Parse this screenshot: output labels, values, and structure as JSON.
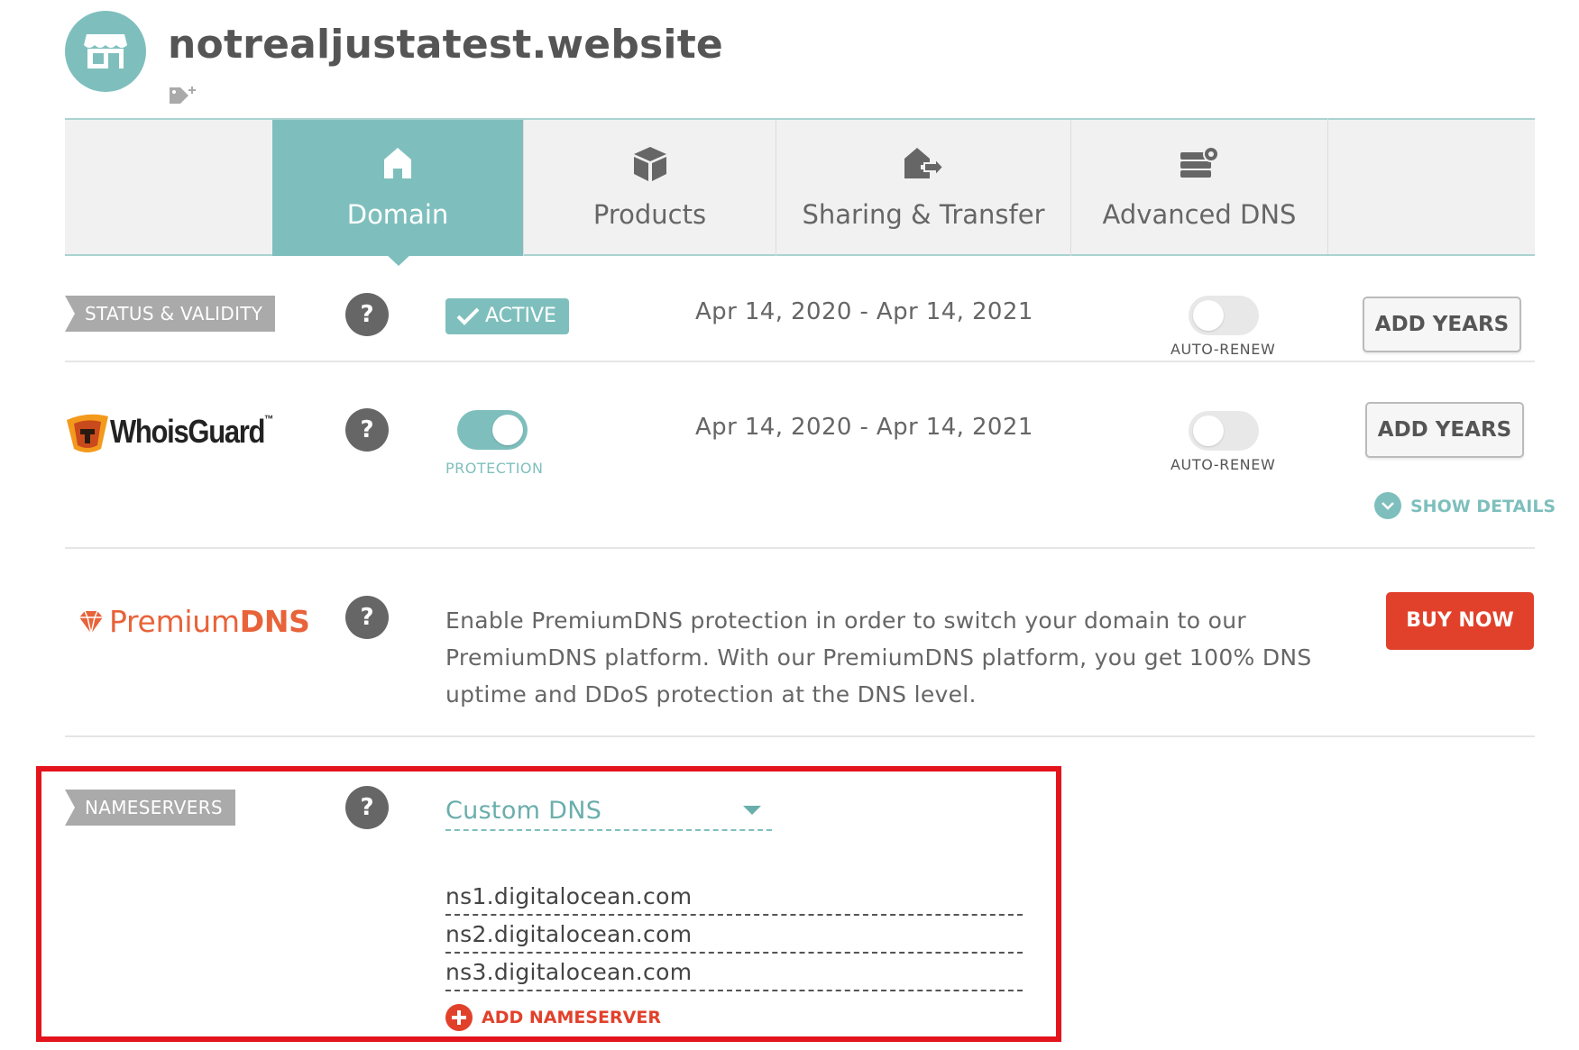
{
  "header": {
    "domain_name": "notrealjustatest.website",
    "avatar_icon": "storefront-icon",
    "tag_icon": "add-tag-icon"
  },
  "tabs": [
    {
      "label": "Domain",
      "icon": "home-icon",
      "active": true
    },
    {
      "label": "Products",
      "icon": "box-icon",
      "active": false
    },
    {
      "label": "Sharing & Transfer",
      "icon": "house-transfer-icon",
      "active": false
    },
    {
      "label": "Advanced DNS",
      "icon": "server-gear-icon",
      "active": false
    }
  ],
  "status": {
    "section_label": "STATUS & VALIDITY",
    "help": "?",
    "badge": "ACTIVE",
    "dates": "Apr 14, 2020 - Apr 14, 2021",
    "auto_renew_label": "AUTO-RENEW",
    "auto_renew_on": false,
    "add_years": "ADD YEARS"
  },
  "whoisguard": {
    "brand": "WhoisGuard",
    "trademark": "™",
    "help": "?",
    "protection_label": "PROTECTION",
    "protection_on": true,
    "dates": "Apr 14, 2020 - Apr 14, 2021",
    "auto_renew_label": "AUTO-RENEW",
    "auto_renew_on": false,
    "add_years": "ADD YEARS",
    "show_details": "SHOW DETAILS"
  },
  "premium_dns": {
    "brand_light": "Premium",
    "brand_bold": "DNS",
    "help": "?",
    "description": "Enable PremiumDNS protection in order to switch your domain to our PremiumDNS platform. With our PremiumDNS platform, you get 100% DNS uptime and DDoS protection at the DNS level.",
    "buy_now": "BUY NOW"
  },
  "nameservers": {
    "section_label": "NAMESERVERS",
    "help": "?",
    "selected_option": "Custom DNS",
    "entries": [
      "ns1.digitalocean.com",
      "ns2.digitalocean.com",
      "ns3.digitalocean.com"
    ],
    "add_label": "ADD NAMESERVER"
  },
  "colors": {
    "teal_accent": "#7ebfbd",
    "red_action": "#e1412b",
    "highlight_border": "#e3141c",
    "premium_orange": "#e8633a"
  }
}
